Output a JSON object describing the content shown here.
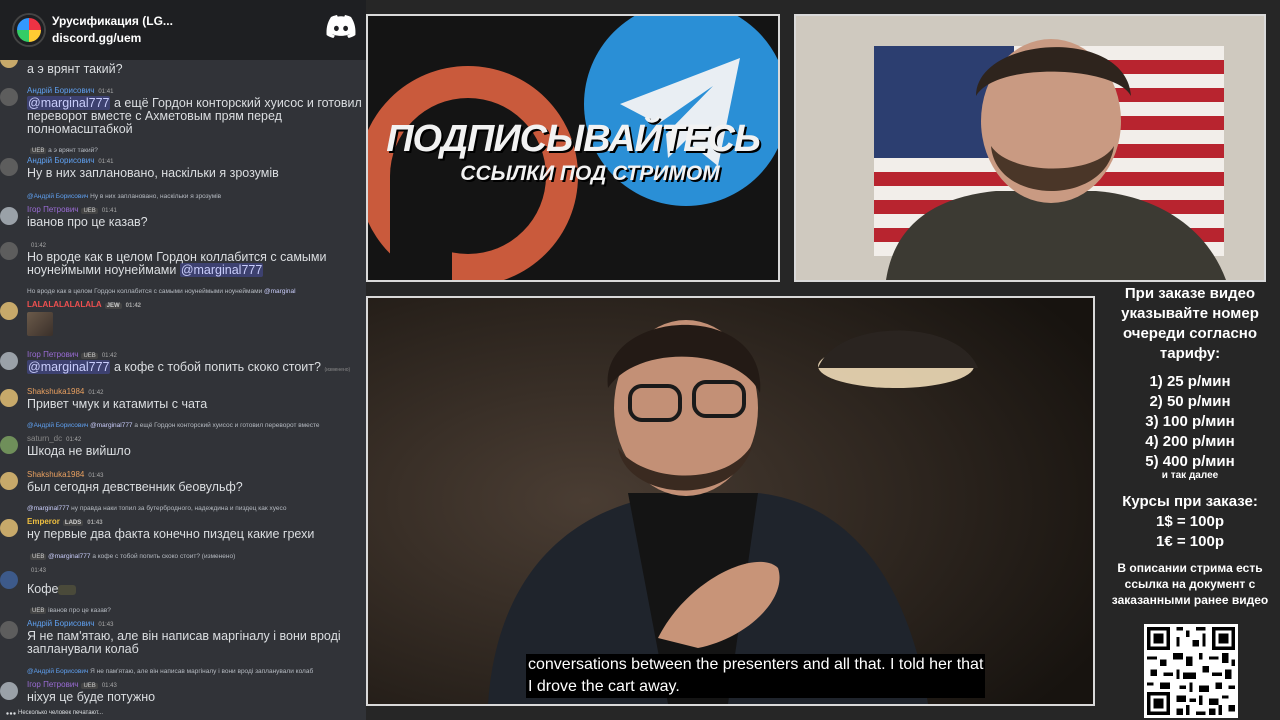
{
  "discord": {
    "server_name": "Урусификация (LG...",
    "server_link": "discord.gg/uem",
    "typing_indicator": "Несколько человек печатают..."
  },
  "messages": [
    {
      "text": "а э врянт такий?"
    },
    {
      "user": "Андрій Борисович",
      "time": "01:41",
      "mention": "@marginal777",
      "text": " а ещё Гордон конторский хуисос и готовил переворот вместе с Ахметовым прям перед полномасштабкой"
    },
    {
      "reply": "а э врянт такий?",
      "reply_badge": "UEB"
    },
    {
      "user": "Андрій Борисович",
      "time": "01:41",
      "text": "Ну в них заплановано, наскільки я зрозумів"
    },
    {
      "reply_user": "@Андрій Борисович",
      "reply": " Ну в них заплановано, наскільки я зрозумів"
    },
    {
      "user": "Ігор Петрович",
      "badge": "UEB",
      "time": "01:41",
      "text": "іванов про це казав?"
    },
    {
      "time": "01:42",
      "text": "Но вроде как в целом Гордон коллабится с самыми ноунеймыми ноунеймами ",
      "mention": "@marginal777"
    },
    {
      "reply": "Но вроде как в целом Гордон коллабится с самыми ноунеймыми ноунеймами",
      "reply_mention": "@marginal"
    },
    {
      "user": "LALALALALALALA",
      "badge": "JEW",
      "time": "01:42"
    },
    {
      "user": "Ігор Петрович",
      "badge": "UEB",
      "time": "01:42",
      "mention": "@marginal777",
      "text": " а кофе с тобой попить скоко стоит?",
      "edited": "(изменено)"
    },
    {
      "user": "Shakshuka1984",
      "time": "01:42",
      "text": "Привет чмук и катамиты с чата"
    },
    {
      "reply_user": "@Андрій Борисович",
      "reply_mention": "@marginal777",
      "reply": " а ещё Гордон конторский хуисос и готовил переворот вместе"
    },
    {
      "user": "saturn_dc",
      "time": "01:42",
      "text": "Шкода не вийшло"
    },
    {
      "user": "Shakshuka1984",
      "time": "01:43",
      "text": "был сегодня девственник беовульф?"
    },
    {
      "reply_mention": "@marginal777",
      "reply": " ну правда наки топил за бутербродного, надеждина и пиздец как хуесо"
    },
    {
      "user": "Emperor",
      "badge": "LADS",
      "time": "01:43",
      "text": "ну первые два факта конечно пиздец какие грехи"
    },
    {
      "reply_badge": "UEB",
      "reply_mention": "@marginal777",
      "reply": " а кофе с тобой попить скоко стоит?",
      "edited": "(изменено)"
    },
    {
      "time": "01:43",
      "text": "Кофе"
    },
    {
      "reply_badge": "UEB",
      "reply": "іванов про це казав?"
    },
    {
      "user": "Андрій Борисович",
      "time": "01:43",
      "text": "Я не пам'ятаю, але він написав маргіналу і вони вроді запланували колаб"
    },
    {
      "reply_user": "@Андрій Борисович",
      "reply": " Я не пам'ятаю, але він написав маргіналу і вони вроді запланували колаб"
    },
    {
      "user": "Ігор Петрович",
      "badge": "UEB",
      "time": "01:43",
      "text": "ніхуя це буде потужно"
    }
  ],
  "promo": {
    "line1": "ПОДПИСЫВАЙТЕСЬ",
    "line2": "ССЫЛКИ ПОД СТРИМОМ"
  },
  "video": {
    "subtitle_line1": "conversations between the presenters and all that. I told her that",
    "subtitle_line2": "I drove the cart away."
  },
  "info": {
    "heading": "При заказе видео указывайте номер очереди согласно тарифу:",
    "tariffs": [
      "1) 25 р/мин",
      "2) 50 р/мин",
      "3) 100 р/мин",
      "4) 200 р/мин",
      "5) 400 р/мин"
    ],
    "etc": "и так далее",
    "rates_title": "Курсы при заказе:",
    "rates": [
      "1$ = 100р",
      "1€ = 100р"
    ],
    "description": "В описании стрима есть ссылка на документ с заказанными ранее видео"
  },
  "colors": {
    "discord_bg": "#313338",
    "mention_blue": "#5865f2",
    "patreon_red": "#c95a3c",
    "telegram_blue": "#2a8fd6"
  }
}
